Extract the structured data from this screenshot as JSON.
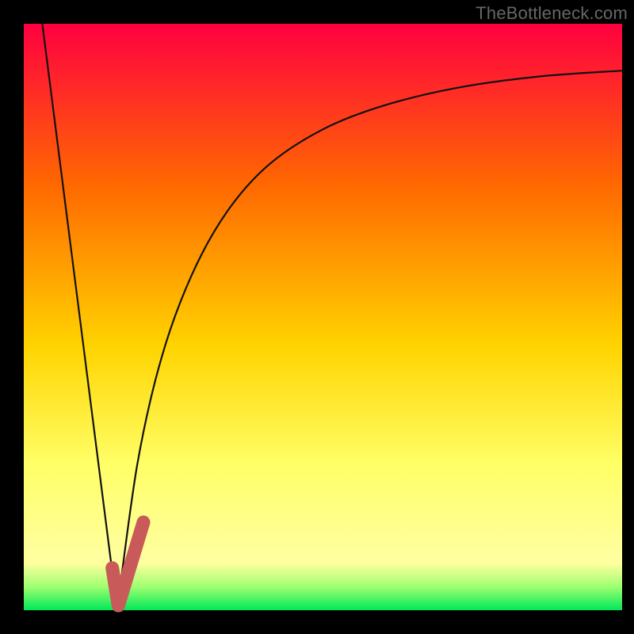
{
  "attribution": "TheBottleneck.com",
  "colors": {
    "page_bg": "#000000",
    "gradient_top": "#ff0040",
    "gradient_mid1": "#ff6a00",
    "gradient_mid2": "#ffd400",
    "gradient_mid3": "#ffff66",
    "gradient_low": "#ffff9e",
    "gradient_bottom_band": "#9eff70",
    "gradient_bottom": "#00e85a",
    "curve_stroke": "#111111",
    "marker_stroke": "#c85a5a"
  },
  "chart_data": {
    "type": "line",
    "title": "",
    "xlabel": "",
    "ylabel": "",
    "xlim": [
      0,
      1
    ],
    "ylim": [
      0,
      1
    ],
    "series": [
      {
        "name": "left-descending-line",
        "x": [
          0.031,
          0.156
        ],
        "values": [
          1.0,
          0.0
        ]
      },
      {
        "name": "right-log-curve",
        "x": [
          0.156,
          0.19,
          0.23,
          0.28,
          0.34,
          0.41,
          0.5,
          0.6,
          0.72,
          0.86,
          1.0
        ],
        "values": [
          0.0,
          0.25,
          0.43,
          0.57,
          0.68,
          0.76,
          0.82,
          0.86,
          0.89,
          0.91,
          0.92
        ]
      }
    ],
    "annotations": [
      {
        "name": "j-marker",
        "type": "path",
        "x": [
          0.148,
          0.158,
          0.2
        ],
        "values": [
          0.072,
          0.008,
          0.15
        ]
      }
    ]
  }
}
